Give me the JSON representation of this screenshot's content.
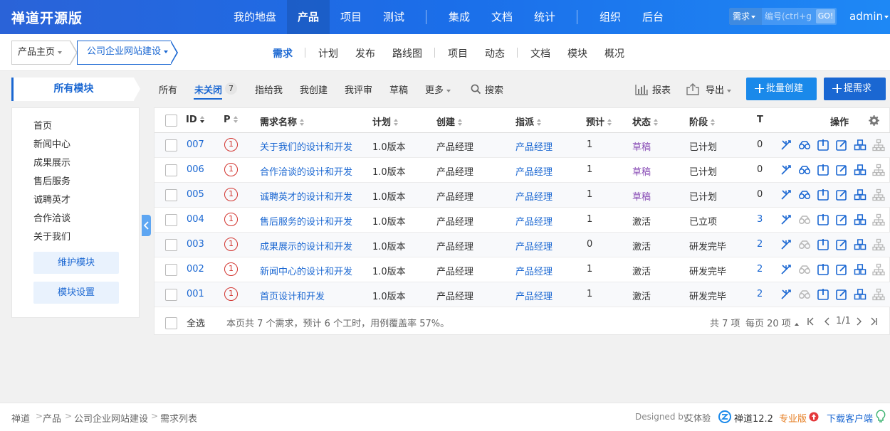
{
  "app": {
    "brand": "禅道开源版",
    "user": "admin"
  },
  "mainnav": [
    {
      "label": "我的地盘",
      "active": false
    },
    {
      "label": "产品",
      "active": true
    },
    {
      "label": "项目",
      "active": false
    },
    {
      "label": "测试",
      "active": false
    },
    {
      "label": "集成",
      "active": false
    },
    {
      "label": "文档",
      "active": false
    },
    {
      "label": "统计",
      "active": false
    },
    {
      "label": "组织",
      "active": false
    },
    {
      "label": "后台",
      "active": false
    }
  ],
  "search": {
    "type": "需求",
    "placeholder": "编号(ctrl+g)",
    "go": "GO!"
  },
  "subheader": {
    "home": "产品主页",
    "product": "公司企业网站建设",
    "tabs": [
      "需求",
      "计划",
      "发布",
      "路线图",
      "项目",
      "动态",
      "文档",
      "模块",
      "概况"
    ]
  },
  "sidebar": {
    "title": "所有模块",
    "modules": [
      "首页",
      "新闻中心",
      "成果展示",
      "售后服务",
      "诚聘英才",
      "合作洽谈",
      "关于我们"
    ],
    "maintain": "维护模块",
    "settings": "模块设置"
  },
  "toolbar": {
    "all": "所有",
    "unclosed": "未关闭",
    "unclosed_count": "7",
    "assigned": "指给我",
    "created": "我创建",
    "reviewed": "我评审",
    "draft": "草稿",
    "more": "更多",
    "search": "搜索",
    "report": "报表",
    "export": "导出",
    "batch_create": "批量创建",
    "create": "提需求"
  },
  "table": {
    "headers": {
      "id": "ID",
      "pri": "P",
      "name": "需求名称",
      "plan": "计划",
      "creator": "创建",
      "assigned": "指派",
      "estimate": "预计",
      "status": "状态",
      "stage": "阶段",
      "tasks": "T",
      "actions": "操作"
    },
    "rows": [
      {
        "id": "007",
        "pri": "1",
        "name": "关于我们的设计和开发",
        "plan": "1.0版本",
        "creator": "产品经理",
        "assigned": "产品经理",
        "estimate": "1",
        "status": "草稿",
        "stage": "已计划",
        "tasks": "0"
      },
      {
        "id": "006",
        "pri": "1",
        "name": "合作洽谈的设计和开发",
        "plan": "1.0版本",
        "creator": "产品经理",
        "assigned": "产品经理",
        "estimate": "1",
        "status": "草稿",
        "stage": "已计划",
        "tasks": "0"
      },
      {
        "id": "005",
        "pri": "1",
        "name": "诚聘英才的设计和开发",
        "plan": "1.0版本",
        "creator": "产品经理",
        "assigned": "产品经理",
        "estimate": "1",
        "status": "草稿",
        "stage": "已计划",
        "tasks": "0"
      },
      {
        "id": "004",
        "pri": "1",
        "name": "售后服务的设计和开发",
        "plan": "1.0版本",
        "creator": "产品经理",
        "assigned": "产品经理",
        "estimate": "1",
        "status": "激活",
        "stage": "已立项",
        "tasks": "3"
      },
      {
        "id": "003",
        "pri": "1",
        "name": "成果展示的设计和开发",
        "plan": "1.0版本",
        "creator": "产品经理",
        "assigned": "产品经理",
        "estimate": "0",
        "status": "激活",
        "stage": "研发完毕",
        "tasks": "2"
      },
      {
        "id": "002",
        "pri": "1",
        "name": "新闻中心的设计和开发",
        "plan": "1.0版本",
        "creator": "产品经理",
        "assigned": "产品经理",
        "estimate": "1",
        "status": "激活",
        "stage": "研发完毕",
        "tasks": "2"
      },
      {
        "id": "001",
        "pri": "1",
        "name": "首页设计和开发",
        "plan": "1.0版本",
        "creator": "产品经理",
        "assigned": "产品经理",
        "estimate": "1",
        "status": "激活",
        "stage": "研发完毕",
        "tasks": "2"
      }
    ],
    "select_all": "全选",
    "summary": "本页共 7 个需求，预计 6 个工时，用例覆盖率 57%。",
    "total": "共 7 项",
    "per_page": "每页 20 项",
    "page": "1/1"
  },
  "footer": {
    "crumbs": [
      "禅道",
      "产品",
      "公司企业网站建设",
      "需求列表"
    ],
    "designed_by": "Designed by",
    "designer": "艾体验",
    "version": "禅道12.2",
    "pro": "专业版",
    "download": "下载客户端"
  },
  "colors": {
    "accent": "#1a67d2",
    "draft": "#8a4fb7",
    "priority": "#d2322d"
  }
}
